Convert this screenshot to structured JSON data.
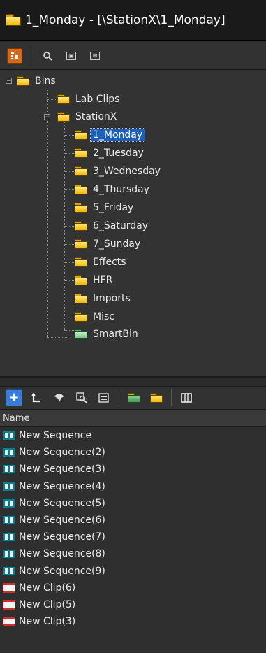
{
  "window": {
    "title": "1_Monday - [\\StationX\\1_Monday]"
  },
  "toolbar_top": {
    "icons": [
      "tree-view-icon",
      "search-icon",
      "find-bin-icon",
      "find-clip-icon"
    ]
  },
  "tree": {
    "root": {
      "label": "Bins",
      "expander": "−"
    },
    "lab_clips": {
      "label": "Lab Clips"
    },
    "stationx": {
      "label": "StationX",
      "expander": "−"
    },
    "children": [
      {
        "label": "1_Monday",
        "selected": true
      },
      {
        "label": "2_Tuesday"
      },
      {
        "label": "3_Wednesday"
      },
      {
        "label": "4_Thursday"
      },
      {
        "label": "5_Friday"
      },
      {
        "label": "6_Saturday"
      },
      {
        "label": "7_Sunday"
      },
      {
        "label": "Effects"
      },
      {
        "label": "HFR"
      },
      {
        "label": "Imports"
      },
      {
        "label": "Misc"
      },
      {
        "label": "SmartBin",
        "type": "smartbin"
      }
    ]
  },
  "toolbar_bottom": {
    "icons": [
      "add-icon",
      "up-level-icon",
      "tool-icon",
      "find-icon",
      "bin-view-icon",
      "new-bin-icon",
      "new-folder-icon",
      "columns-icon"
    ]
  },
  "list": {
    "column_name": "Name",
    "items": [
      {
        "label": "New Sequence",
        "type": "sequence"
      },
      {
        "label": "New Sequence(2)",
        "type": "sequence"
      },
      {
        "label": "New Sequence(3)",
        "type": "sequence"
      },
      {
        "label": "New Sequence(4)",
        "type": "sequence"
      },
      {
        "label": "New Sequence(5)",
        "type": "sequence"
      },
      {
        "label": "New Sequence(6)",
        "type": "sequence"
      },
      {
        "label": "New Sequence(7)",
        "type": "sequence"
      },
      {
        "label": "New Sequence(8)",
        "type": "sequence"
      },
      {
        "label": "New Sequence(9)",
        "type": "sequence"
      },
      {
        "label": "New Clip(6)",
        "type": "clip"
      },
      {
        "label": "New Clip(5)",
        "type": "clip"
      },
      {
        "label": "New Clip(3)",
        "type": "clip"
      }
    ]
  },
  "colors": {
    "selection": "#1b5fbf",
    "active_tool": "#d46a1e",
    "folder": "#f0b800",
    "smartbin": "#6cc583"
  }
}
